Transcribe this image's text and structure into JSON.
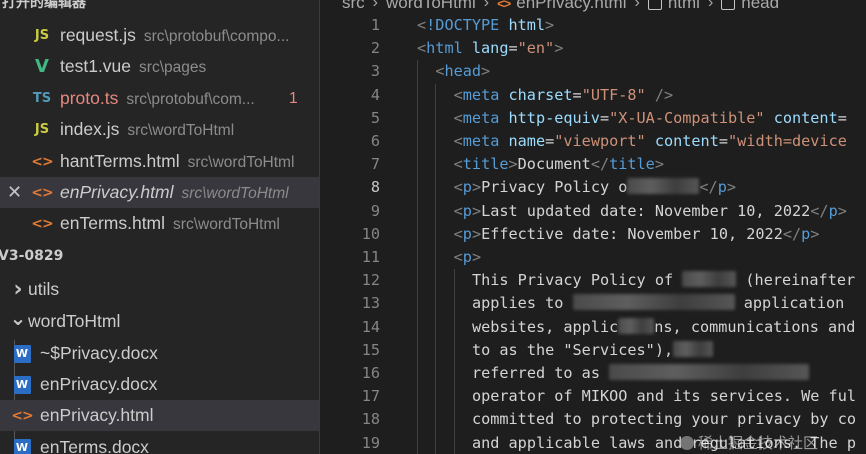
{
  "sidebar": {
    "open_editors_title": "打开的编辑器",
    "open_editors": [
      {
        "icon": "js-file-icon",
        "icon_text": "JS",
        "name": "request.js",
        "desc": "src\\protobuf\\compo..."
      },
      {
        "icon": "vue-file-icon",
        "icon_text": "V",
        "name": "test1.vue",
        "desc": "src\\pages"
      },
      {
        "icon": "ts-file-icon",
        "icon_text": "TS",
        "name": "proto.ts",
        "desc": "src\\protobuf\\com...",
        "badge": "1",
        "name_color": "#e7877f"
      },
      {
        "icon": "js-file-icon",
        "icon_text": "JS",
        "name": "index.js",
        "desc": "src\\wordToHtml"
      },
      {
        "icon": "html-file-icon",
        "icon_text": "<>",
        "name": "hantTerms.html",
        "desc": "src\\wordToHtml"
      },
      {
        "icon": "html-file-icon",
        "icon_text": "<>",
        "name": "enPrivacy.html",
        "desc": "src\\wordToHtml",
        "active": true,
        "close_glyph": "✕"
      },
      {
        "icon": "html-file-icon",
        "icon_text": "<>",
        "name": "enTerms.html",
        "desc": "src\\wordToHtml"
      }
    ],
    "project_title": "V3-0829",
    "tree": [
      {
        "icon": "chevron-right-icon",
        "glyph": "›",
        "name": "utils"
      },
      {
        "icon": "chevron-down-icon",
        "glyph": "⌄",
        "name": "wordToHtml"
      },
      {
        "icon": "word-file-icon",
        "glyph": "W",
        "name": "~$Privacy.docx"
      },
      {
        "icon": "word-file-icon",
        "glyph": "W",
        "name": "enPrivacy.docx"
      },
      {
        "icon": "html-file-icon",
        "glyph": "<>",
        "name": "enPrivacy.html",
        "active": true
      },
      {
        "icon": "word-file-icon",
        "glyph": "W",
        "name": "enTerms.docx"
      }
    ]
  },
  "breadcrumb": {
    "items": [
      "src",
      "wordToHtml",
      "enPrivacy.html",
      "html",
      "head"
    ],
    "separator": "›"
  },
  "editor": {
    "current_line": "8",
    "lines": [
      {
        "n": "1",
        "indent": 0,
        "tokens": [
          [
            "punc",
            "<"
          ],
          [
            "tag",
            "!DOCTYPE"
          ],
          [
            "text",
            " "
          ],
          [
            "attr",
            "html"
          ],
          [
            "punc",
            ">"
          ]
        ]
      },
      {
        "n": "2",
        "indent": 0,
        "tokens": [
          [
            "punc",
            "<"
          ],
          [
            "tag",
            "html"
          ],
          [
            "text",
            " "
          ],
          [
            "attr",
            "lang"
          ],
          [
            "text",
            "="
          ],
          [
            "str",
            "\"en\""
          ],
          [
            "punc",
            ">"
          ]
        ]
      },
      {
        "n": "3",
        "indent": 1,
        "tokens": [
          [
            "punc",
            "<"
          ],
          [
            "tag",
            "head"
          ],
          [
            "punc",
            ">"
          ]
        ]
      },
      {
        "n": "4",
        "indent": 2,
        "tokens": [
          [
            "punc",
            "<"
          ],
          [
            "tag",
            "meta"
          ],
          [
            "text",
            " "
          ],
          [
            "attr",
            "charset"
          ],
          [
            "text",
            "="
          ],
          [
            "str",
            "\"UTF-8\""
          ],
          [
            "text",
            " "
          ],
          [
            "punc",
            "/>"
          ]
        ]
      },
      {
        "n": "5",
        "indent": 2,
        "tokens": [
          [
            "punc",
            "<"
          ],
          [
            "tag",
            "meta"
          ],
          [
            "text",
            " "
          ],
          [
            "attr",
            "http-equiv"
          ],
          [
            "text",
            "="
          ],
          [
            "str",
            "\"X-UA-Compatible\""
          ],
          [
            "text",
            " "
          ],
          [
            "attr",
            "content"
          ],
          [
            "text",
            "="
          ]
        ]
      },
      {
        "n": "6",
        "indent": 2,
        "tokens": [
          [
            "punc",
            "<"
          ],
          [
            "tag",
            "meta"
          ],
          [
            "text",
            " "
          ],
          [
            "attr",
            "name"
          ],
          [
            "text",
            "="
          ],
          [
            "str",
            "\"viewport\""
          ],
          [
            "text",
            " "
          ],
          [
            "attr",
            "content"
          ],
          [
            "text",
            "="
          ],
          [
            "str",
            "\"width=device"
          ]
        ]
      },
      {
        "n": "7",
        "indent": 2,
        "tokens": [
          [
            "punc",
            "<"
          ],
          [
            "tag",
            "title"
          ],
          [
            "punc",
            ">"
          ],
          [
            "text",
            "Document"
          ],
          [
            "punc",
            "</"
          ],
          [
            "tag",
            "title"
          ],
          [
            "punc",
            ">"
          ]
        ]
      },
      {
        "n": "8",
        "indent": 2,
        "tokens": [
          [
            "punc",
            "<"
          ],
          [
            "tag",
            "p"
          ],
          [
            "punc",
            ">"
          ],
          [
            "text",
            "Privacy Policy o"
          ],
          [
            "blur",
            "72"
          ],
          [
            "punc",
            "</"
          ],
          [
            "tag",
            "p"
          ],
          [
            "punc",
            ">"
          ]
        ]
      },
      {
        "n": "9",
        "indent": 2,
        "tokens": [
          [
            "punc",
            "<"
          ],
          [
            "tag",
            "p"
          ],
          [
            "punc",
            ">"
          ],
          [
            "text",
            "Last updated date: November 10, 2022"
          ],
          [
            "punc",
            "</"
          ],
          [
            "tag",
            "p"
          ],
          [
            "punc",
            ">"
          ]
        ]
      },
      {
        "n": "10",
        "indent": 2,
        "tokens": [
          [
            "punc",
            "<"
          ],
          [
            "tag",
            "p"
          ],
          [
            "punc",
            ">"
          ],
          [
            "text",
            "Effective date: November 10, 2022"
          ],
          [
            "punc",
            "</"
          ],
          [
            "tag",
            "p"
          ],
          [
            "punc",
            ">"
          ]
        ]
      },
      {
        "n": "11",
        "indent": 2,
        "tokens": [
          [
            "punc",
            "<"
          ],
          [
            "tag",
            "p"
          ],
          [
            "punc",
            ">"
          ]
        ]
      },
      {
        "n": "12",
        "indent": 3,
        "tokens": [
          [
            "text",
            "This Privacy Policy of "
          ],
          [
            "blur",
            "54"
          ],
          [
            "text",
            " (hereinafter"
          ]
        ]
      },
      {
        "n": "13",
        "indent": 3,
        "tokens": [
          [
            "text",
            "applies to "
          ],
          [
            "blur",
            "162"
          ],
          [
            "text",
            " application"
          ]
        ]
      },
      {
        "n": "14",
        "indent": 3,
        "tokens": [
          [
            "text",
            "websites, applic"
          ],
          [
            "blur",
            "36"
          ],
          [
            "text",
            "ns, communications and"
          ]
        ]
      },
      {
        "n": "15",
        "indent": 3,
        "tokens": [
          [
            "text",
            "to as the \"Services\"),"
          ],
          [
            "blur",
            "40"
          ]
        ]
      },
      {
        "n": "16",
        "indent": 3,
        "tokens": [
          [
            "text",
            "referred to as "
          ],
          [
            "blur",
            "200"
          ]
        ]
      },
      {
        "n": "17",
        "indent": 3,
        "tokens": [
          [
            "text",
            "operator of MIKOO and its services. We ful"
          ]
        ]
      },
      {
        "n": "18",
        "indent": 3,
        "tokens": [
          [
            "text",
            "committed to protecting your privacy by co"
          ]
        ]
      },
      {
        "n": "19",
        "indent": 3,
        "tokens": [
          [
            "text",
            "and applicable laws and regulations. The p"
          ]
        ]
      }
    ]
  },
  "watermark": "稀土掘金技术社区"
}
